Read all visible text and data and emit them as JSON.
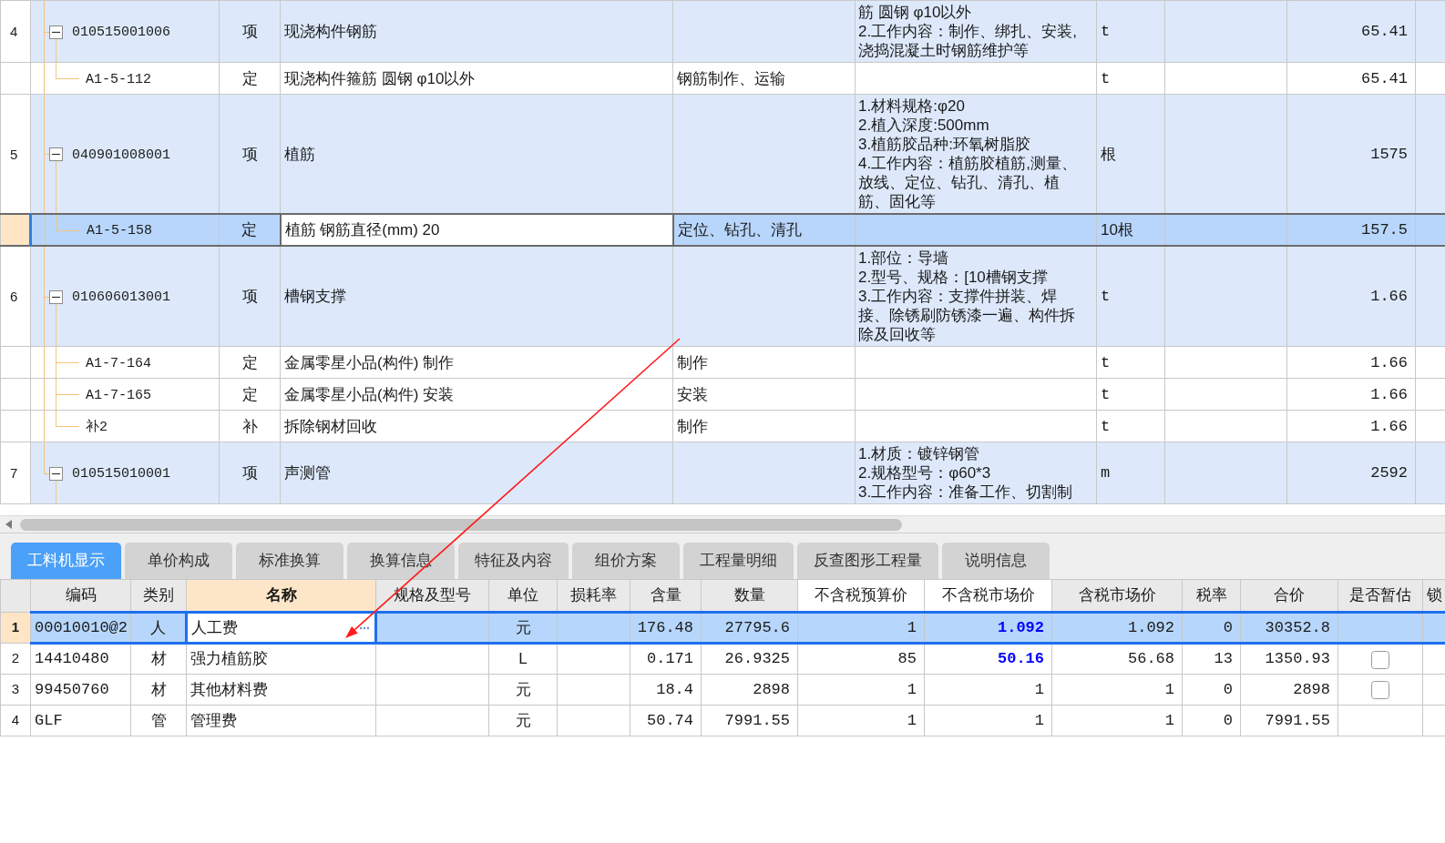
{
  "bill_table": {
    "rows": [
      {
        "row_number": "4",
        "column_1": "010515001006",
        "column_2": "项",
        "column_3": "现浇构件钢筋",
        "column_5": [
          "筋 圆钢 φ10以外",
          "2.工作内容：制作、绑扎、安装,浇捣混凝土时钢筋维护等"
        ],
        "column_6": "t",
        "column_8": "65.41",
        "expanded": true,
        "selected": false,
        "children": [
          {
            "column_1": "A1-5-112",
            "column_2": "定",
            "column_3": "现浇构件箍筋 圆钢 φ10以外",
            "column_4": "钢筋制作、运输",
            "column_6": "t",
            "column_8": "65.41",
            "selected": false
          }
        ]
      },
      {
        "row_number": "5",
        "column_1": "040901008001",
        "column_2": "项",
        "column_3": "植筋",
        "column_5": [
          "1.材料规格:φ20",
          "2.植入深度:500mm",
          "3.植筋胶品种:环氧树脂胶",
          "4.工作内容：植筋胶植筋,测量、放线、定位、钻孔、清孔、植筋、固化等"
        ],
        "column_6": "根",
        "column_8": "1575",
        "expanded": true,
        "selected": false,
        "children": [
          {
            "column_1": "A1-5-158",
            "column_2": "定",
            "column_3": "植筋 钢筋直径(mm) 20",
            "column_4": "定位、钻孔、清孔",
            "column_6": "10根",
            "column_8": "157.5",
            "selected": true
          }
        ]
      },
      {
        "row_number": "6",
        "column_1": "010606013001",
        "column_2": "项",
        "column_3": "槽钢支撑",
        "column_5": [
          "1.部位：导墙",
          "2.型号、规格：[10槽钢支撑",
          "3.工作内容：支撑件拼装、焊接、除锈刷防锈漆一遍、构件拆除及回收等"
        ],
        "column_6": "t",
        "column_8": "1.66",
        "expanded": true,
        "selected": false,
        "children": [
          {
            "column_1": "A1-7-164",
            "column_2": "定",
            "column_3": "金属零星小品(构件) 制作",
            "column_4": "制作",
            "column_6": "t",
            "column_8": "1.66",
            "selected": false
          },
          {
            "column_1": "A1-7-165",
            "column_2": "定",
            "column_3": "金属零星小品(构件) 安装",
            "column_4": "安装",
            "column_6": "t",
            "column_8": "1.66",
            "selected": false
          },
          {
            "column_1": "补2",
            "column_2": "补",
            "column_3": "拆除钢材回收",
            "column_4": "制作",
            "column_6": "t",
            "column_8": "1.66",
            "selected": false
          }
        ]
      },
      {
        "row_number": "7",
        "column_1": "010515010001",
        "column_2": "项",
        "column_3": "声测管",
        "column_5": [
          "1.材质：镀锌钢管",
          "2.规格型号：φ60*3",
          "3.工作内容：准备工作、切割制"
        ],
        "column_6": "m",
        "column_8": "2592",
        "expanded": true,
        "selected": false
      }
    ]
  },
  "detail_tabs": [
    {
      "label": "工料机显示",
      "selected": true
    },
    {
      "label": "单价构成",
      "selected": false
    },
    {
      "label": "标准换算",
      "selected": false
    },
    {
      "label": "换算信息",
      "selected": false
    },
    {
      "label": "特征及内容",
      "selected": false
    },
    {
      "label": "组价方案",
      "selected": false
    },
    {
      "label": "工程量明细",
      "selected": false
    },
    {
      "label": "反查图形工程量",
      "selected": false
    },
    {
      "label": "说明信息",
      "selected": false
    }
  ],
  "resource_table": {
    "columns": [
      {
        "label": "编码",
        "selected": false,
        "editable": false
      },
      {
        "label": "类别",
        "selected": false,
        "editable": false
      },
      {
        "label": "名称",
        "selected": true,
        "editable": false
      },
      {
        "label": "规格及型号",
        "selected": false,
        "editable": false
      },
      {
        "label": "单位",
        "selected": false,
        "editable": false
      },
      {
        "label": "损耗率",
        "selected": false,
        "editable": false
      },
      {
        "label": "含量",
        "selected": false,
        "editable": false
      },
      {
        "label": "数量",
        "selected": false,
        "editable": false
      },
      {
        "label": "不含税预算价",
        "selected": false,
        "editable": true
      },
      {
        "label": "不含税市场价",
        "selected": false,
        "editable": true
      },
      {
        "label": "含税市场价",
        "selected": false,
        "editable": false
      },
      {
        "label": "税率",
        "selected": false,
        "editable": false
      },
      {
        "label": "合价",
        "selected": false,
        "editable": false
      },
      {
        "label": "是否暂估",
        "selected": false,
        "editable": false
      },
      {
        "label": "锁",
        "selected": false,
        "editable": false
      }
    ],
    "rows": [
      {
        "row_number": "1",
        "code": "00010010@2",
        "category": "人",
        "name": "人工费",
        "unit": "元",
        "content": "176.48",
        "quantity": "27795.6",
        "budget_price": "1",
        "market_price": "1.092",
        "market_price_tax": "1.092",
        "tax_rate": "0",
        "total": "30352.8",
        "market_price_adjusted": true,
        "selected": true
      },
      {
        "row_number": "2",
        "code": "14410480",
        "category": "材",
        "name": "强力植筋胶",
        "unit": "L",
        "content": "0.171",
        "quantity": "26.9325",
        "budget_price": "85",
        "market_price": "50.16",
        "market_price_tax": "56.68",
        "tax_rate": "13",
        "total": "1350.93",
        "provisional_checkbox": {
          "checked": false
        },
        "market_price_adjusted": true,
        "selected": false
      },
      {
        "row_number": "3",
        "code": "99450760",
        "category": "材",
        "name": "其他材料费",
        "unit": "元",
        "content": "18.4",
        "quantity": "2898",
        "budget_price": "1",
        "market_price": "1",
        "market_price_tax": "1",
        "tax_rate": "0",
        "total": "2898",
        "provisional_checkbox": {
          "checked": false
        },
        "market_price_adjusted": false,
        "selected": false
      },
      {
        "row_number": "4",
        "code": "GLF",
        "category": "管",
        "name": "管理费",
        "unit": "元",
        "content": "50.74",
        "quantity": "7991.55",
        "budget_price": "1",
        "market_price": "1",
        "market_price_tax": "1",
        "tax_rate": "0",
        "total": "7991.55",
        "market_price_adjusted": false,
        "selected": false
      }
    ]
  }
}
